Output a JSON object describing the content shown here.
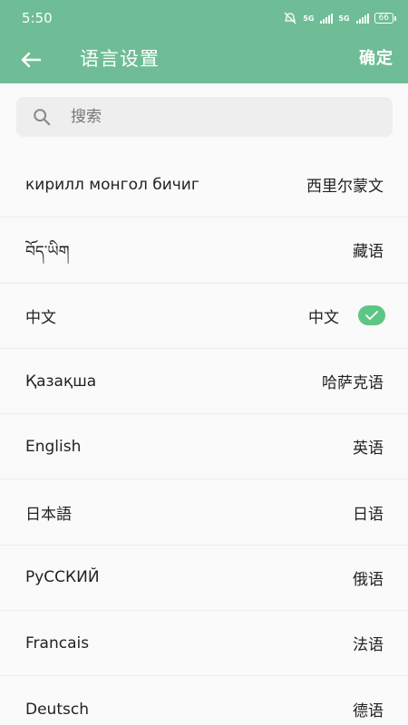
{
  "status_bar": {
    "time": "5:50",
    "net1": "5G",
    "net2": "5G",
    "battery": "66"
  },
  "toolbar": {
    "title": "语言设置",
    "confirm_label": "确定",
    "back_icon": "arrow-left-icon"
  },
  "search": {
    "placeholder": "搜索",
    "value": ""
  },
  "languages": [
    {
      "name": "кирилл монгол бичиг",
      "cn": "西里尔蒙文",
      "selected": false
    },
    {
      "name": "བོད་ཡིག",
      "cn": "藏语",
      "selected": false
    },
    {
      "name": "中文",
      "cn": "中文",
      "selected": true
    },
    {
      "name": "Қазақша",
      "cn": "哈萨克语",
      "selected": false
    },
    {
      "name": "English",
      "cn": "英语",
      "selected": false
    },
    {
      "name": "日本語",
      "cn": "日语",
      "selected": false
    },
    {
      "name": "РуССКИЙ",
      "cn": "俄语",
      "selected": false
    },
    {
      "name": "Francais",
      "cn": "法语",
      "selected": false
    },
    {
      "name": "Deutsch",
      "cn": "德语",
      "selected": false
    }
  ],
  "colors": {
    "appbar": "#6fbd96",
    "check": "#5dc685"
  }
}
